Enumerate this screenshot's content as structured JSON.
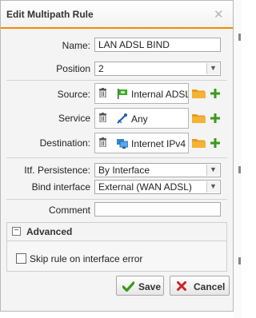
{
  "dialog": {
    "title": "Edit Multipath Rule"
  },
  "form": {
    "name_label": "Name:",
    "name_value": "LAN ADSL BIND",
    "position_label": "Position",
    "position_value": "2",
    "source_label": "Source:",
    "source_value": "Internal ADSL",
    "service_label": "Service",
    "service_value": "Any",
    "destination_label": "Destination:",
    "destination_value": "Internet IPv4",
    "persistence_label": "Itf. Persistence:",
    "persistence_value": "By Interface",
    "bind_label": "Bind interface",
    "bind_value": "External (WAN ADSL)",
    "comment_label": "Comment",
    "comment_value": ""
  },
  "advanced": {
    "title": "Advanced",
    "skip_label": "Skip rule on interface error",
    "skip_checked": false
  },
  "buttons": {
    "save_label": "Save",
    "cancel_label": "Cancel"
  },
  "colors": {
    "accent": "#f08c00",
    "add_green": "#3a9a1a",
    "cancel_red": "#cc2222"
  }
}
